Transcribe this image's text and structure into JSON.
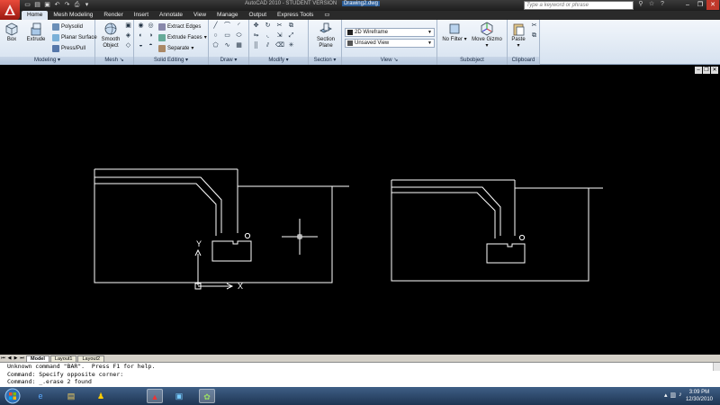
{
  "window": {
    "title": "AutoCAD 2010 - STUDENT VERSION",
    "filename": "Drawing2.dwg",
    "search_placeholder": "Type a keyword or phrase"
  },
  "tabs": [
    {
      "label": "Home",
      "active": true
    },
    {
      "label": "Mesh Modeling"
    },
    {
      "label": "Render"
    },
    {
      "label": "Insert"
    },
    {
      "label": "Annotate"
    },
    {
      "label": "View"
    },
    {
      "label": "Manage"
    },
    {
      "label": "Output"
    },
    {
      "label": "Express Tools"
    }
  ],
  "ribbon": {
    "modeling": {
      "label": "Modeling",
      "box": "Box",
      "extrude": "Extrude",
      "polysolid": "Polysolid",
      "planar_surface": "Planar Surface",
      "presspull": "Press/Pull"
    },
    "mesh": {
      "label": "Mesh",
      "smooth": "Smooth",
      "object": "Object"
    },
    "solid_editing": {
      "label": "Solid Editing",
      "extract_edges": "Extract Edges",
      "extrude_faces": "Extrude Faces",
      "separate": "Separate"
    },
    "draw": {
      "label": "Draw"
    },
    "modify": {
      "label": "Modify"
    },
    "section": {
      "label": "Section",
      "section": "Section",
      "plane": "Plane"
    },
    "view": {
      "label": "View",
      "visual_style": "2D Wireframe",
      "saved_view": "Unsaved View"
    },
    "subobject": {
      "label": "Subobject",
      "no_filter": "No Filter",
      "move_gizmo": "Move Gizmo"
    },
    "clipboard": {
      "label": "Clipboard",
      "paste": "Paste"
    }
  },
  "ucs": {
    "y_label": "Y",
    "x_label": "X"
  },
  "layout_tabs": [
    {
      "label": "Model",
      "active": true
    },
    {
      "label": "Layout1"
    },
    {
      "label": "Layout2"
    }
  ],
  "command_history": [
    "Unknown command \"BAR\".  Press F1 for help.",
    "Command: Specify opposite corner:",
    "Command: _.erase 2 found"
  ],
  "clock": {
    "time": "3:09 PM",
    "date": "12/30/2010"
  },
  "colors": {
    "ribbon_bg": "#dde7f3",
    "viewport_bg": "#000000",
    "geometry_stroke": "#ffffff",
    "taskbar": "#2a4468"
  }
}
